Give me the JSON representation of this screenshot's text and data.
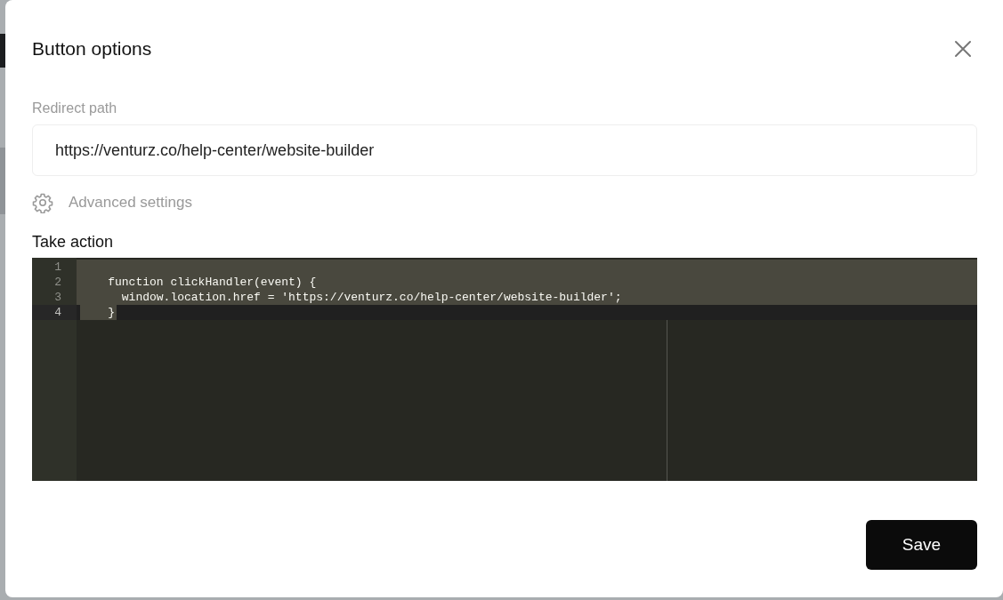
{
  "dialog": {
    "title": "Button options"
  },
  "redirect_field": {
    "label": "Redirect path",
    "value": "https://venturz.co/help-center/website-builder"
  },
  "advanced_settings": {
    "label": "Advanced settings"
  },
  "code_editor": {
    "label": "Take action",
    "lines": [
      {
        "number": "1",
        "selected": true,
        "active": false
      },
      {
        "number": "2",
        "code": "    function clickHandler(event) {",
        "selected": true,
        "active": false
      },
      {
        "number": "3",
        "code": "      window.location.href = 'https://venturz.co/help-center/website-builder';",
        "selected": true,
        "active": false
      },
      {
        "number": "4",
        "code": "    }",
        "selected": true,
        "active": true
      }
    ]
  },
  "buttons": [
    {
      "label": "Save",
      "kind": "primary"
    }
  ]
}
